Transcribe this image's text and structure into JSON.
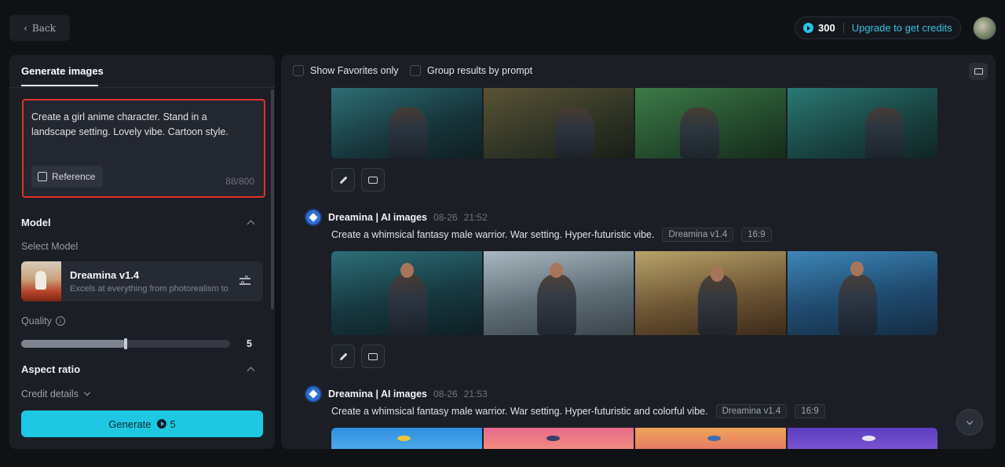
{
  "topbar": {
    "back_label": "Back",
    "credits": "300",
    "upgrade_label": "Upgrade to get credits"
  },
  "left_panel": {
    "tab": "Generate images",
    "prompt": "Create a girl anime character. Stand in a landscape setting. Lovely vibe. Cartoon style.",
    "reference_label": "Reference",
    "char_count": "88/800",
    "model_section": {
      "title": "Model",
      "select_label": "Select Model",
      "model_name": "Dreamina v1.4",
      "model_desc": "Excels at everything from photorealism to painterly styles"
    },
    "quality": {
      "label": "Quality",
      "value": "5",
      "level_fraction": 0.5
    },
    "aspect_ratio_title": "Aspect ratio",
    "credit_details_label": "Credit details",
    "generate": {
      "label": "Generate",
      "cost": "5"
    }
  },
  "right_panel": {
    "show_favorites_label": "Show Favorites only",
    "group_results_label": "Group results by prompt",
    "entries": [
      {
        "name": "Dreamina | AI images",
        "date": "08-26",
        "time": "21:52",
        "prompt": "Create a whimsical fantasy male warrior. War setting. Hyper-futuristic vibe.",
        "model_tag": "Dreamina v1.4",
        "ratio_tag": "16:9"
      },
      {
        "name": "Dreamina | AI images",
        "date": "08-26",
        "time": "21:53",
        "prompt": "Create a whimsical fantasy male warrior. War setting. Hyper-futuristic and colorful vibe.",
        "model_tag": "Dreamina v1.4",
        "ratio_tag": "16:9"
      }
    ]
  },
  "colors": {
    "accent": "#1ec8e3",
    "highlight_border": "#e0302a",
    "panel_bg": "#1b1e25",
    "page_bg": "#0f1115"
  },
  "icons": [
    "chevron-left-icon",
    "credit-coin-icon",
    "reference-image-icon",
    "settings-sliders-icon",
    "info-icon",
    "chevron-up-icon",
    "chevron-down-icon",
    "folder-icon",
    "edit-pencil-icon",
    "regenerate-icon",
    "dreamina-logo-icon"
  ]
}
